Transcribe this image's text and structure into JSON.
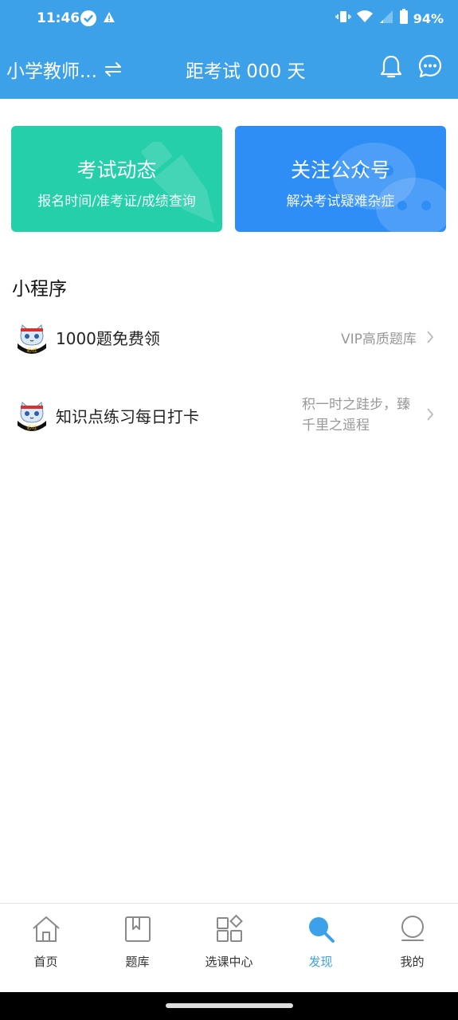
{
  "status_bar": {
    "time": "11:46",
    "battery": "94%"
  },
  "app_bar": {
    "subject": "小学教师...",
    "countdown": "距考试 000 天"
  },
  "cards": [
    {
      "title": "考试动态",
      "subtitle": "报名时间/准考证/成绩查询",
      "color": "#25cfaa"
    },
    {
      "title": "关注公众号",
      "subtitle": "解决考试疑难杂症",
      "color": "#2f8ef6"
    }
  ],
  "mini_programs": {
    "title": "小程序",
    "items": [
      {
        "name": "1000题免费领",
        "desc": "VIP高质题库",
        "logo_text": "必过"
      },
      {
        "name": "知识点练习每日打卡",
        "desc": "积一时之跬步，臻千里之遥程",
        "logo_text": "必过"
      }
    ]
  },
  "bottom_nav": {
    "tabs": [
      {
        "label": "首页",
        "icon": "home-icon"
      },
      {
        "label": "题库",
        "icon": "question-bank-icon"
      },
      {
        "label": "选课中心",
        "icon": "grid-icon"
      },
      {
        "label": "发现",
        "icon": "search-icon",
        "active": true
      },
      {
        "label": "我的",
        "icon": "profile-icon"
      }
    ]
  },
  "colors": {
    "primary": "#3da1ea",
    "green_card": "#25cfaa",
    "blue_card": "#2f8ef6"
  }
}
